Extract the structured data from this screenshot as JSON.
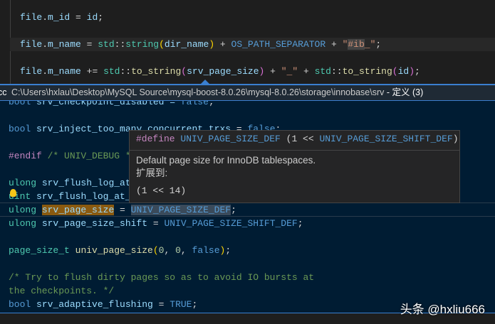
{
  "editor": {
    "lines": [
      [
        [
          "file",
          "var"
        ],
        [
          ".",
          "pl"
        ],
        [
          "m_id",
          "var"
        ],
        [
          " = ",
          "pl"
        ],
        [
          "id",
          "var"
        ],
        [
          ";",
          "pl"
        ]
      ],
      [
        [
          "file",
          "var"
        ],
        [
          ".",
          "pl"
        ],
        [
          "m_name",
          "var"
        ],
        [
          " = ",
          "pl"
        ],
        [
          "std",
          "ty"
        ],
        [
          "::",
          "pl"
        ],
        [
          "string",
          "ty"
        ],
        [
          "(",
          "by"
        ],
        [
          "dir_name",
          "var"
        ],
        [
          ")",
          "by"
        ],
        [
          " + ",
          "pl"
        ],
        [
          "OS_PATH_SEPARATOR",
          "mac"
        ],
        [
          " + ",
          "pl"
        ],
        [
          "\"",
          "str"
        ],
        [
          "#ib",
          "str w-hash"
        ],
        [
          "_\"",
          "str"
        ],
        [
          ";",
          "pl"
        ]
      ],
      [
        [
          "file",
          "var"
        ],
        [
          ".",
          "pl"
        ],
        [
          "m_name",
          "var"
        ],
        [
          " += ",
          "pl"
        ],
        [
          "std",
          "ty"
        ],
        [
          "::",
          "pl"
        ],
        [
          "to_string",
          "fn"
        ],
        [
          "(",
          "br"
        ],
        [
          "srv_page_size",
          "var"
        ],
        [
          ")",
          "br"
        ],
        [
          " + ",
          "pl"
        ],
        [
          "\"_\"",
          "str"
        ],
        [
          " + ",
          "pl"
        ],
        [
          "std",
          "ty"
        ],
        [
          "::",
          "pl"
        ],
        [
          "to_string",
          "fn"
        ],
        [
          "(",
          "br"
        ],
        [
          "id",
          "var"
        ],
        [
          ")",
          "br"
        ],
        [
          ";",
          "pl"
        ]
      ]
    ]
  },
  "peek": {
    "path": "C:\\Users\\hxlau\\Desktop\\MySQL Source\\mysql-boost-8.0.26\\mysql-8.0.26\\storage\\innobase\\srv",
    "prefix": "cc",
    "title_suffix": " - 定义 (3)",
    "lines": [
      [
        [
          "bool",
          "kw"
        ],
        [
          " srv_checkpoint_disabled = ",
          "var"
        ],
        [
          "false",
          "kw"
        ],
        [
          ";",
          "pl"
        ]
      ],
      [],
      [
        [
          "bool",
          "kw"
        ],
        [
          " ",
          "pl"
        ],
        [
          "srv_inject_too_many_concurrent_trxs",
          "var"
        ],
        [
          " = ",
          "pl"
        ],
        [
          "false",
          "kw"
        ],
        [
          ";",
          "pl"
        ]
      ],
      [],
      [
        [
          "#endif",
          "pp"
        ],
        [
          " /* UNIV_DEBUG */",
          "cm"
        ]
      ],
      [],
      [
        [
          "ulong",
          "ty"
        ],
        [
          " ",
          "pl"
        ],
        [
          "srv_flush_log_at_timeout",
          "var"
        ]
      ],
      [
        [
          "uint",
          "ty"
        ],
        [
          " ",
          "pl"
        ],
        [
          "srv_flush_log_at_trx_commit",
          "var"
        ]
      ],
      [
        [
          "ulong",
          "ty"
        ],
        [
          " ",
          "pl"
        ],
        [
          "srv_page_size",
          "var w-sel"
        ],
        [
          " = ",
          "pl"
        ],
        [
          "UNIV_PAGE_SIZE_DEF",
          "mac w-ref"
        ],
        [
          ";",
          "pl"
        ]
      ],
      [
        [
          "ulong",
          "ty"
        ],
        [
          " ",
          "pl"
        ],
        [
          "srv_page_size_shift",
          "var"
        ],
        [
          " = ",
          "pl"
        ],
        [
          "UNIV_PAGE_SIZE_SHIFT_DEF",
          "mac"
        ],
        [
          ";",
          "pl"
        ]
      ],
      [],
      [
        [
          "page_size_t",
          "ty"
        ],
        [
          " ",
          "pl"
        ],
        [
          "univ_page_size",
          "fn"
        ],
        [
          "(",
          "by"
        ],
        [
          "0",
          "num"
        ],
        [
          ", ",
          "pl"
        ],
        [
          "0",
          "num"
        ],
        [
          ", ",
          "pl"
        ],
        [
          "false",
          "kw"
        ],
        [
          ")",
          "by"
        ],
        [
          ";",
          "pl"
        ]
      ],
      [],
      [
        [
          "/* Try to flush dirty pages so as to avoid IO bursts at",
          "cm"
        ]
      ],
      [
        [
          "the checkpoints. */",
          "cm"
        ]
      ],
      [
        [
          "bool",
          "kw"
        ],
        [
          " ",
          "pl"
        ],
        [
          "srv_adaptive_flushing",
          "var"
        ],
        [
          " = ",
          "pl"
        ],
        [
          "TRUE",
          "kw"
        ],
        [
          ";",
          "pl"
        ]
      ]
    ]
  },
  "hover": {
    "signature": [
      [
        "#define",
        "pp"
      ],
      [
        " UNIV_PAGE_SIZE_DEF ",
        "mac"
      ],
      [
        "(1 << ",
        "pl"
      ],
      [
        "UNIV_PAGE_SIZE_SHIFT_DEF",
        "mac"
      ],
      [
        ")",
        "pl"
      ]
    ],
    "doc": "Default page size for InnoDB tablespaces.",
    "expands_label": "扩展到:",
    "expansion": "(1 << 14)"
  },
  "watermark": "头条 @hxliu666"
}
